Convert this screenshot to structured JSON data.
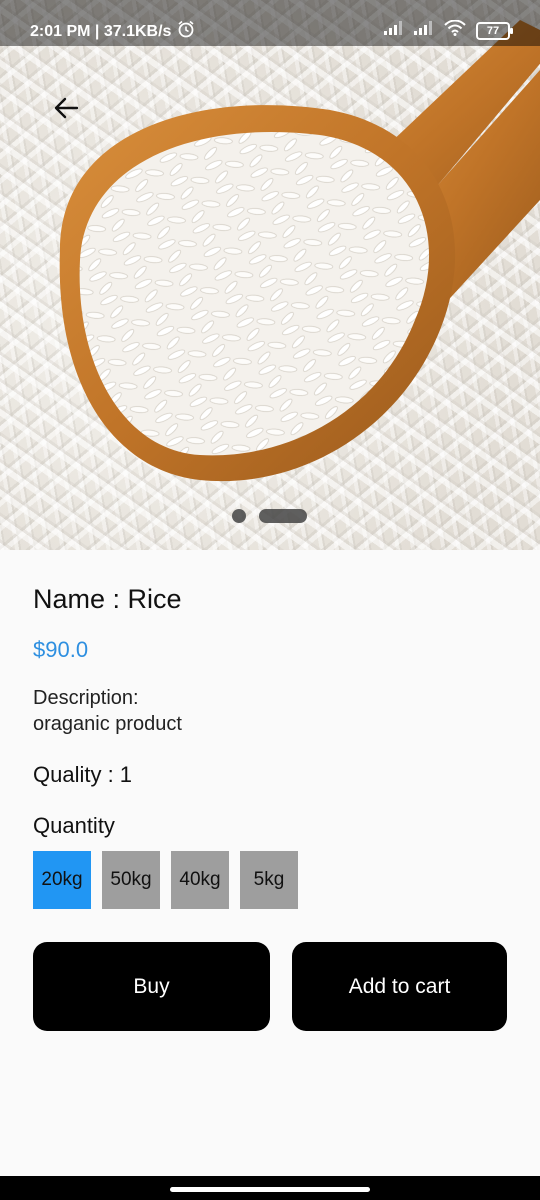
{
  "status_bar": {
    "time_speed": "2:01 PM | 37.1KB/s",
    "battery": "77",
    "icons": [
      "alarm-icon",
      "signal-icon",
      "signal-icon",
      "wifi-icon",
      "battery-icon"
    ]
  },
  "hero": {
    "image": "rice-in-wooden-spoon",
    "carousel_pages": 2,
    "carousel_active_index": 1
  },
  "product": {
    "name": "Name : Rice",
    "price": "$90.0",
    "description_label": "Description:",
    "description": "oraganic product",
    "quality": "Quality : 1"
  },
  "quantity": {
    "title": "Quantity",
    "options": [
      "20kg",
      "50kg",
      "40kg",
      "5kg"
    ],
    "selected": "20kg"
  },
  "actions": {
    "buy": "Buy",
    "add_to_cart": "Add to cart"
  },
  "colors": {
    "accent": "#2196f3",
    "price": "#2e8fe0",
    "chip": "#9e9e9e",
    "button": "#000000"
  }
}
